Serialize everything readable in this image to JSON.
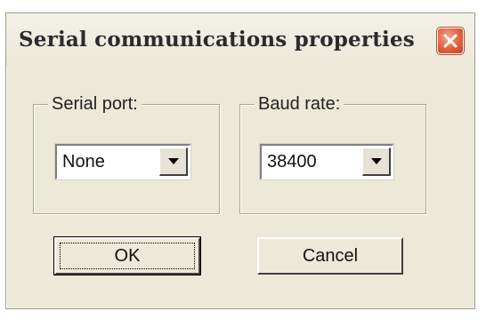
{
  "window": {
    "title": "Serial communications properties",
    "close_icon": "close-icon",
    "close_color": "#e2613e"
  },
  "serial_port": {
    "label": "Serial port:",
    "value": "None",
    "arrow_icon": "chevron-down-icon"
  },
  "baud_rate": {
    "label": "Baud rate:",
    "value": "38400",
    "arrow_icon": "chevron-down-icon"
  },
  "buttons": {
    "ok_label": "OK",
    "cancel_label": "Cancel"
  },
  "colors": {
    "dialog_bg": "#ece9d8",
    "group_border": "#a8a797"
  }
}
